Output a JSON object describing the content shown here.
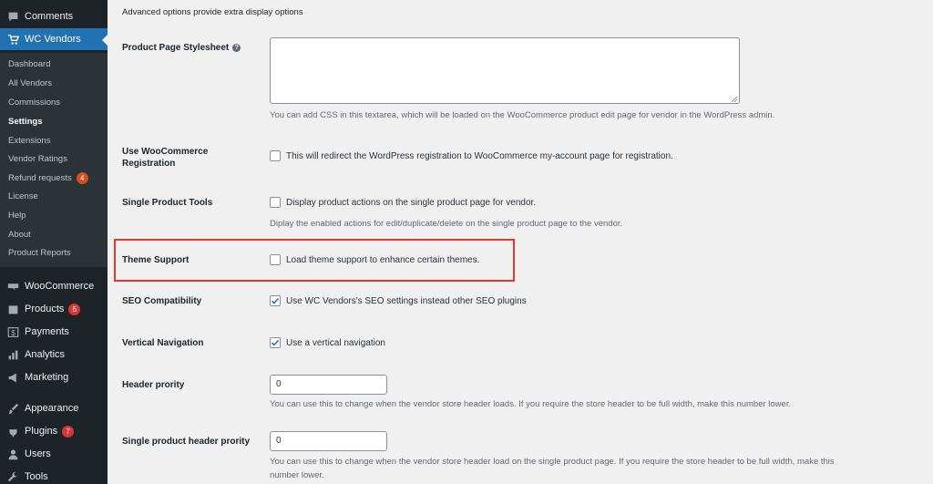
{
  "sidebar": {
    "top_items": [
      {
        "label": "Comments",
        "icon": "comment-icon"
      },
      {
        "label": "WC Vendors",
        "icon": "cart-icon"
      }
    ],
    "submenu": [
      {
        "label": "Dashboard"
      },
      {
        "label": "All Vendors"
      },
      {
        "label": "Commissions"
      },
      {
        "label": "Settings"
      },
      {
        "label": "Extensions"
      },
      {
        "label": "Vendor Ratings"
      },
      {
        "label": "Refund requests",
        "badge": "4"
      },
      {
        "label": "License"
      },
      {
        "label": "Help"
      },
      {
        "label": "About"
      },
      {
        "label": "Product Reports"
      }
    ],
    "bottom_items": [
      {
        "label": "WooCommerce",
        "icon": "woocommerce-icon"
      },
      {
        "label": "Products",
        "icon": "box-icon",
        "badge": "5"
      },
      {
        "label": "Payments",
        "icon": "dollar-icon"
      },
      {
        "label": "Analytics",
        "icon": "bar-chart-icon"
      },
      {
        "label": "Marketing",
        "icon": "megaphone-icon"
      },
      {
        "label": "Appearance",
        "icon": "brush-icon"
      },
      {
        "label": "Plugins",
        "icon": "plug-icon",
        "badge": "7"
      },
      {
        "label": "Users",
        "icon": "user-icon"
      },
      {
        "label": "Tools",
        "icon": "wrench-icon"
      }
    ]
  },
  "main": {
    "intro": "Advanced options provide extra display options",
    "stylesheet": {
      "label": "Product Page Stylesheet",
      "value": "",
      "desc": "You can add CSS in this textarea, which will be loaded on the WooCommerce product edit page for vendor in the WordPress admin."
    },
    "woo_registration": {
      "label": "Use WooCommerce Registration",
      "checkbox_label": "This will redirect the WordPress registration to WooCommerce my-account page for registration.",
      "checked": false
    },
    "single_product_tools": {
      "label": "Single Product Tools",
      "checkbox_label": "Display product actions on the single product page for vendor.",
      "checked": false,
      "desc": "Diplay the enabled actions for edit/duplicate/delete on the single product page to the vendor."
    },
    "theme_support": {
      "label": "Theme Support",
      "checkbox_label": "Load theme support to enhance certain themes.",
      "checked": false
    },
    "seo": {
      "label": "SEO Compatibility",
      "checkbox_label": "Use WC Vendors's SEO settings instead other SEO plugins",
      "checked": true
    },
    "vertical_nav": {
      "label": "Vertical Navigation",
      "checkbox_label": "Use a vertical navigation",
      "checked": true
    },
    "header_priority": {
      "label": "Header prority",
      "value": "0",
      "desc": "You can use this to change when the vendor store header loads. If you require the store header to be full width, make this number lower."
    },
    "single_header_priority": {
      "label": "Single product header prority",
      "value": "0",
      "desc_line1": "You can use this to change when the vendor store header load on the single product page. If you require the store header to be full width, make this",
      "desc_line2": "number lower."
    }
  },
  "colors": {
    "sidebar_bg": "#1d2327",
    "submenu_bg": "#2c3338",
    "active_blue": "#2271b1",
    "highlight_red": "#e8362b",
    "checkbox_blue": "#2271b1"
  }
}
